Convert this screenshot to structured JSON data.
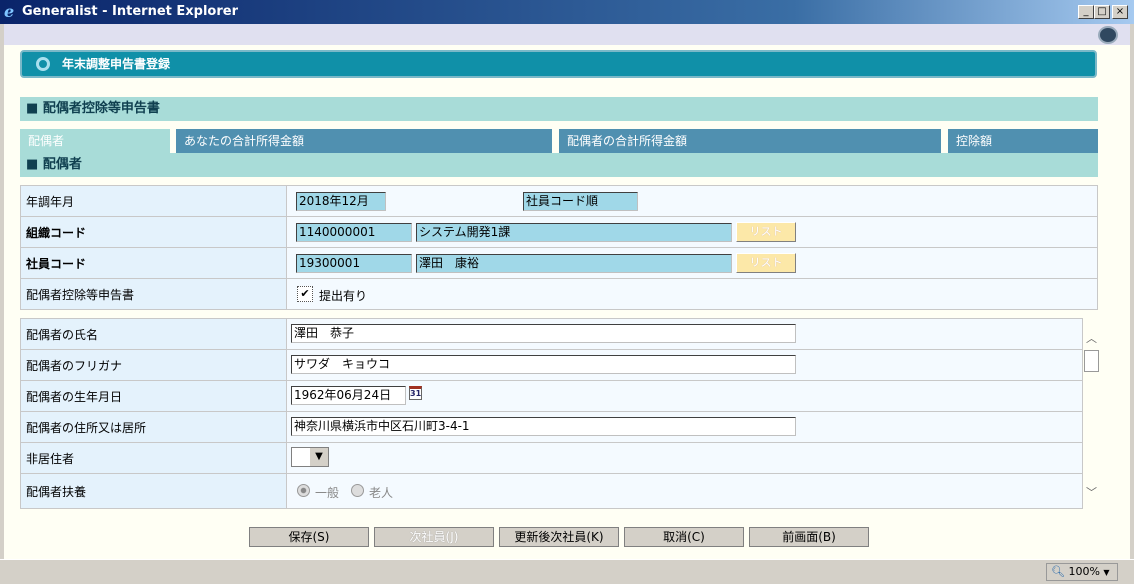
{
  "window": {
    "title": "Generalist - Internet Explorer",
    "min": "_",
    "max": "□",
    "close": "×"
  },
  "page": {
    "title": "年末調整申告書登録",
    "section": "配偶者控除等申告書",
    "subsection": "配偶者"
  },
  "tabs": [
    {
      "label": "配偶者",
      "active": true
    },
    {
      "label": "あなたの合計所得金額"
    },
    {
      "label": "配偶者の合計所得金額"
    },
    {
      "label": "控除額"
    }
  ],
  "top_form": {
    "year_label": "年調年月",
    "year_value": "2018年12月",
    "order_value": "社員コード順",
    "org_label": "組織コード",
    "org_code": "1140000001",
    "org_name": "システム開発1課",
    "list": "リスト",
    "emp_label": "社員コード",
    "emp_code": "19300001",
    "emp_name": "澤田　康裕",
    "decl_label": "配偶者控除等申告書",
    "decl_check": "提出有り",
    "decl_checked": true
  },
  "spouse_form": {
    "name_label": "配偶者の氏名",
    "name": "澤田　恭子",
    "kana_label": "配偶者のフリガナ",
    "kana": "サワダ　キョウコ",
    "birth_label": "配偶者の生年月日",
    "birth": "1962年06月24日",
    "cal_icon": "31",
    "addr_label": "配偶者の住所又は居所",
    "addr": "神奈川県横浜市中区石川町3-4-1",
    "nonres_label": "非居住者",
    "dep_label": "配偶者扶養",
    "dep_opt1": "一般",
    "dep_opt2": "老人",
    "dep_selected": "一般"
  },
  "buttons": {
    "save": "保存(S)",
    "next": "次社員(J)",
    "update_next": "更新後次社員(K)",
    "cancel": "取消(C)",
    "back": "前画面(B)"
  },
  "status": {
    "zoom": "100%"
  }
}
